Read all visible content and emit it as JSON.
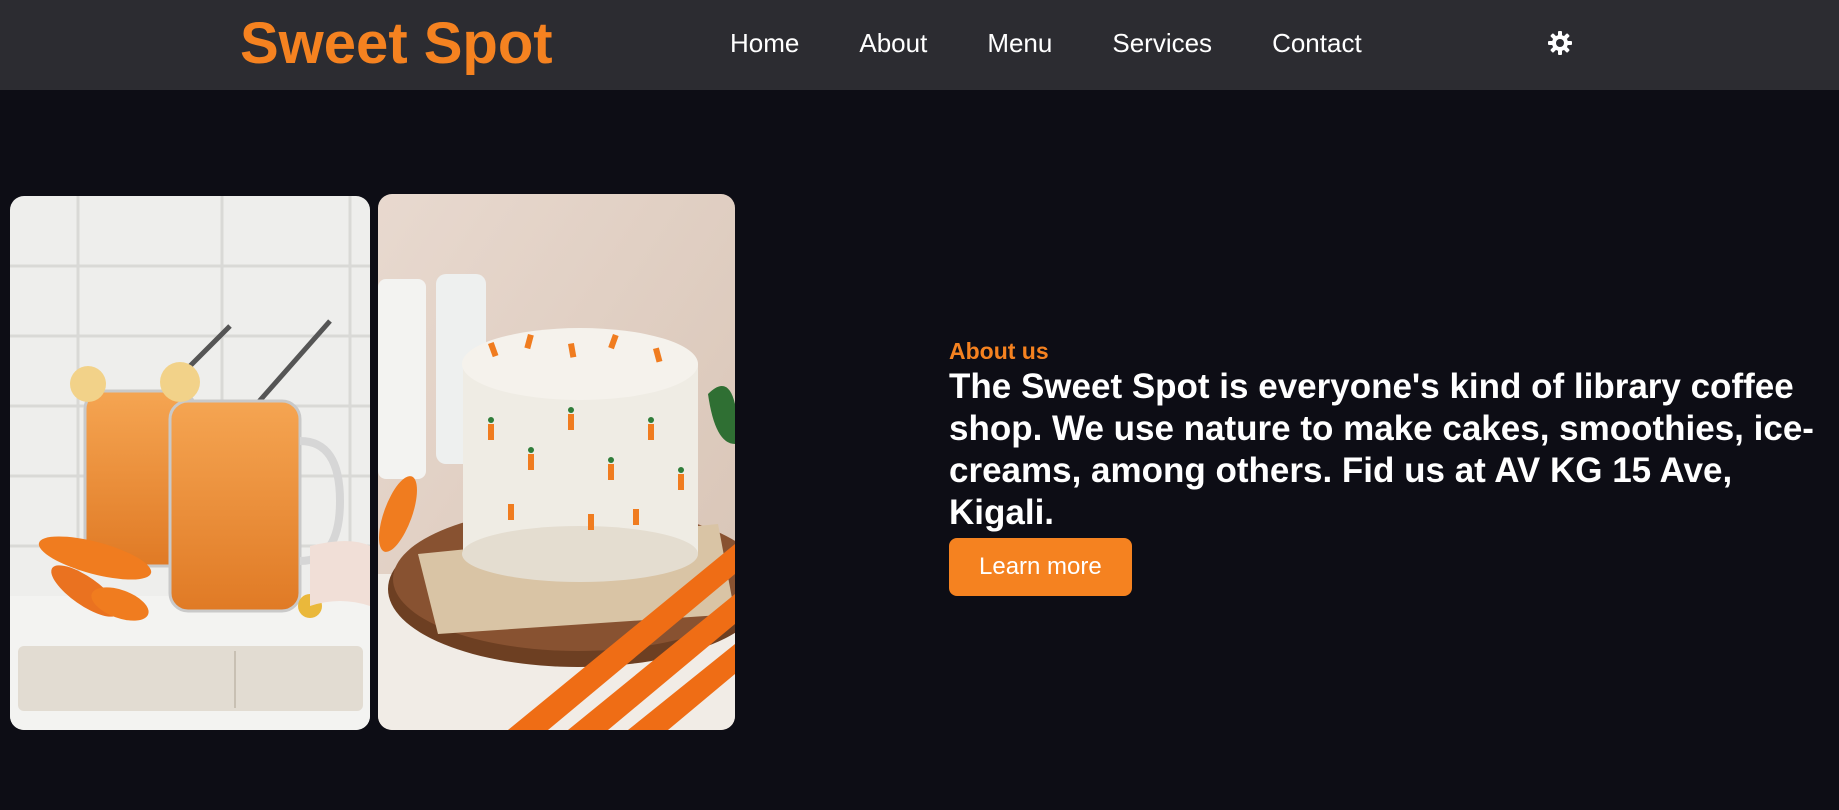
{
  "brand": {
    "name": "Sweet Spot",
    "accent_color": "#f58220"
  },
  "nav": {
    "items": [
      {
        "label": "Home"
      },
      {
        "label": "About"
      },
      {
        "label": "Menu"
      },
      {
        "label": "Services"
      },
      {
        "label": "Contact"
      }
    ],
    "theme_toggle_icon": "sun-gear-icon"
  },
  "hero": {
    "images": [
      {
        "subject": "carrot-smoothie-jars"
      },
      {
        "subject": "carrot-cake"
      }
    ],
    "eyebrow": "About us",
    "text": "The Sweet Spot is everyone's kind of library coffee shop. We use nature to make cakes, smoothies, ice-creams, among others. Fid us at AV KG 15 Ave, Kigali.",
    "cta_label": "Learn more"
  },
  "colors": {
    "background": "#0d0d15",
    "navbar": "#2c2c31",
    "accent": "#f58220",
    "text": "#ffffff"
  }
}
